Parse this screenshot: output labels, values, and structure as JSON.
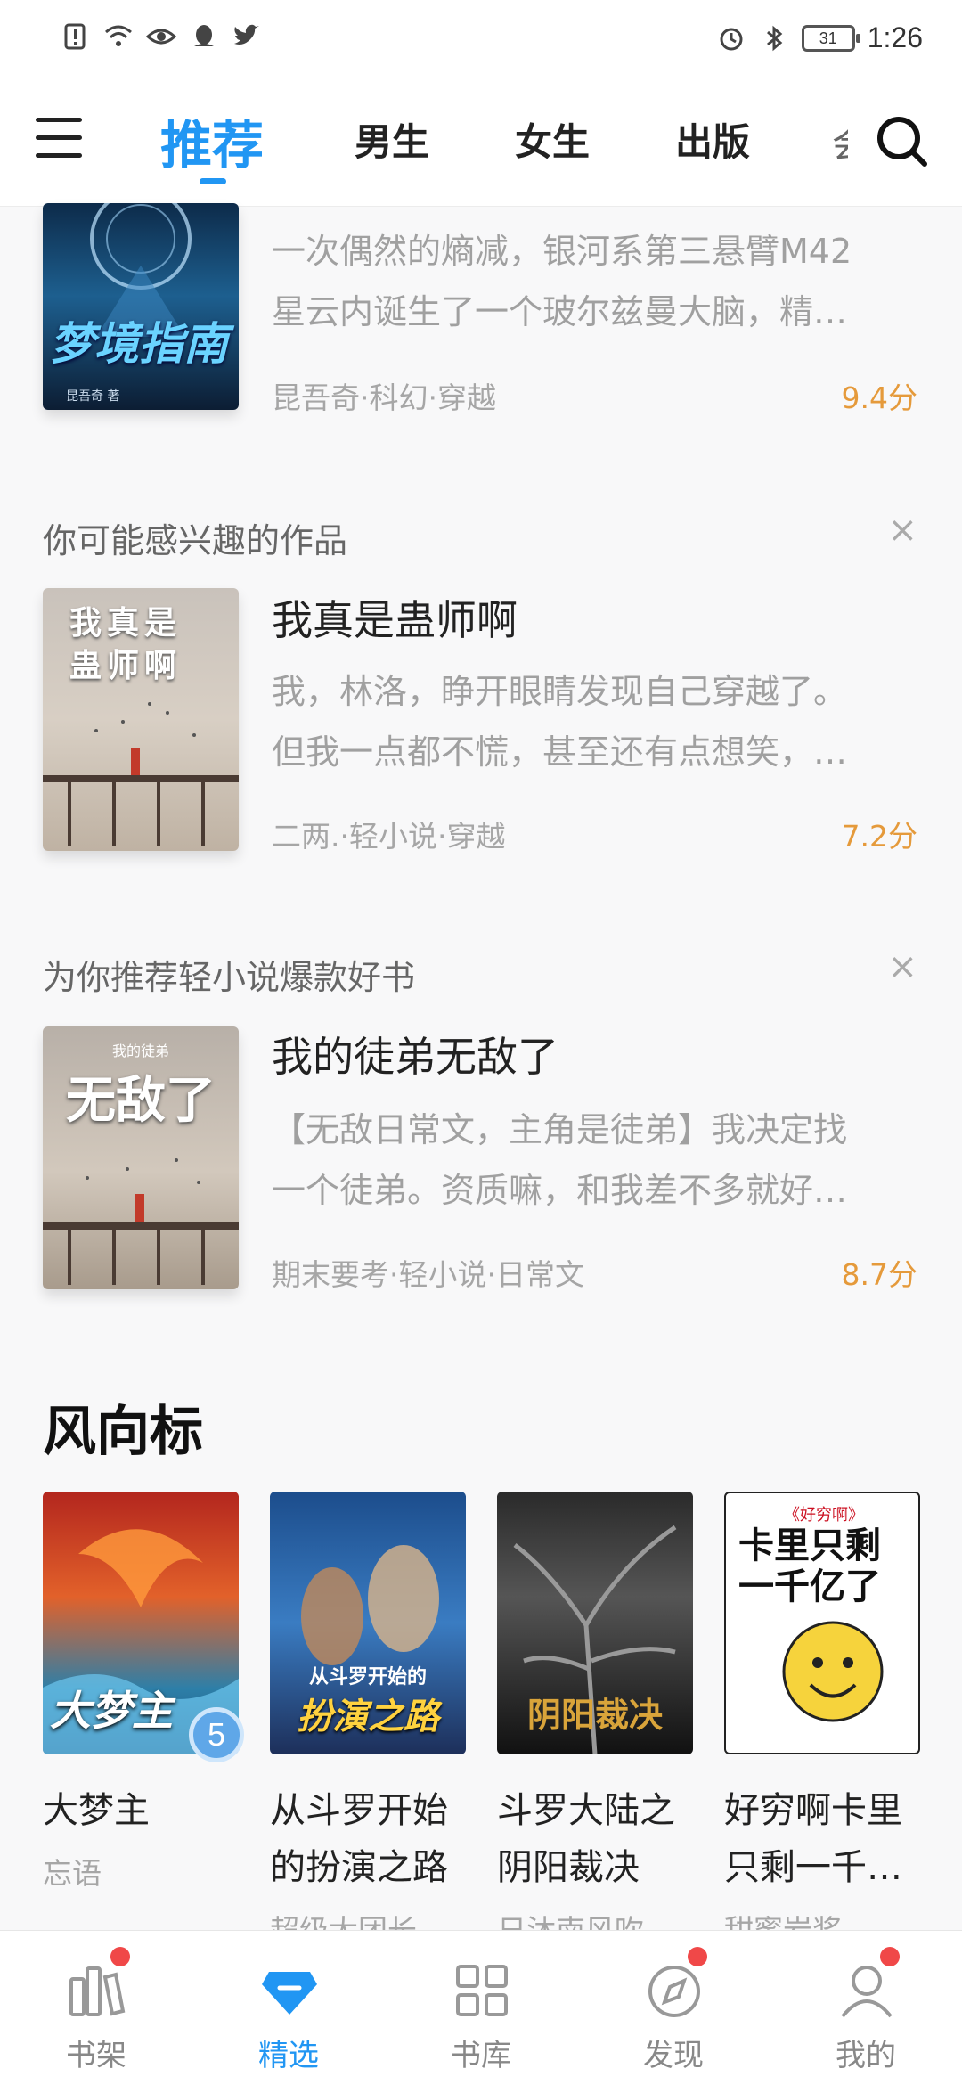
{
  "status_bar": {
    "time": "1:26",
    "battery": "31",
    "icons": [
      "alert-icon",
      "wifi-icon",
      "eye-icon",
      "qq-icon",
      "twitter-icon",
      "alarm-icon",
      "bluetooth-icon",
      "battery-icon"
    ]
  },
  "top_nav": {
    "tabs": [
      {
        "label": "推荐",
        "active": true
      },
      {
        "label": "男生"
      },
      {
        "label": "女生"
      },
      {
        "label": "出版"
      },
      {
        "label": "会"
      }
    ]
  },
  "feed": {
    "items": [
      {
        "title": "",
        "desc_line1": "一次偶然的熵减，银河系第三悬臂M42",
        "desc_line2": "星云内诞生了一个玻尔兹曼大脑，精…",
        "meta": "昆吾奇·科幻·穿越",
        "score": "9.4分",
        "cover_text": "梦境指南",
        "cover_author": "昆吾奇 著"
      },
      {
        "section": "你可能感兴趣的作品",
        "title": "我真是蛊师啊",
        "desc_line1": "我，林洛，睁开眼睛发现自己穿越了。",
        "desc_line2": "但我一点都不慌，甚至还有点想笑，…",
        "meta": "二两.·轻小说·穿越",
        "score": "7.2分",
        "cover_text": "我真是蛊师啊"
      },
      {
        "section": "为你推荐轻小说爆款好书",
        "title": "我的徒弟无敌了",
        "desc_line1": "【无敌日常文，主角是徒弟】我决定找",
        "desc_line2": "一个徒弟。资质嘛，和我差不多就好…",
        "meta": "期末要考·轻小说·日常文",
        "score": "8.7分",
        "cover_text": "无敌了",
        "cover_top": "我的徒弟"
      }
    ]
  },
  "vane": {
    "title": "风向标",
    "books": [
      {
        "name1": "大梦主",
        "name2": "",
        "author": "忘语",
        "badge": "5",
        "cover_text": "大梦主"
      },
      {
        "name1": "从斗罗开始",
        "name2": "的扮演之路",
        "author": "超级大团长",
        "cover_text": "扮演之路",
        "cover_top": "从斗罗开始的"
      },
      {
        "name1": "斗罗大陆之",
        "name2": "阴阳裁决",
        "author": "日沐南风吹",
        "cover_text": "阴阳裁决"
      },
      {
        "name1": "好穷啊卡里",
        "name2": "只剩一千…",
        "author": "甜蜜岩浆",
        "cover_text": "卡里只剩一千亿了",
        "cover_top": "《好穷啊》"
      }
    ]
  },
  "bottom_nav": [
    {
      "label": "书架",
      "icon": "bookshelf-icon",
      "dot": true
    },
    {
      "label": "精选",
      "icon": "diamond-icon",
      "active": true
    },
    {
      "label": "书库",
      "icon": "grid-icon"
    },
    {
      "label": "发现",
      "icon": "compass-icon",
      "dot": true
    },
    {
      "label": "我的",
      "icon": "user-icon",
      "dot": true
    }
  ],
  "colors": {
    "accent": "#2196f3",
    "score": "#e59a3b",
    "badge_dot": "#f04848"
  }
}
